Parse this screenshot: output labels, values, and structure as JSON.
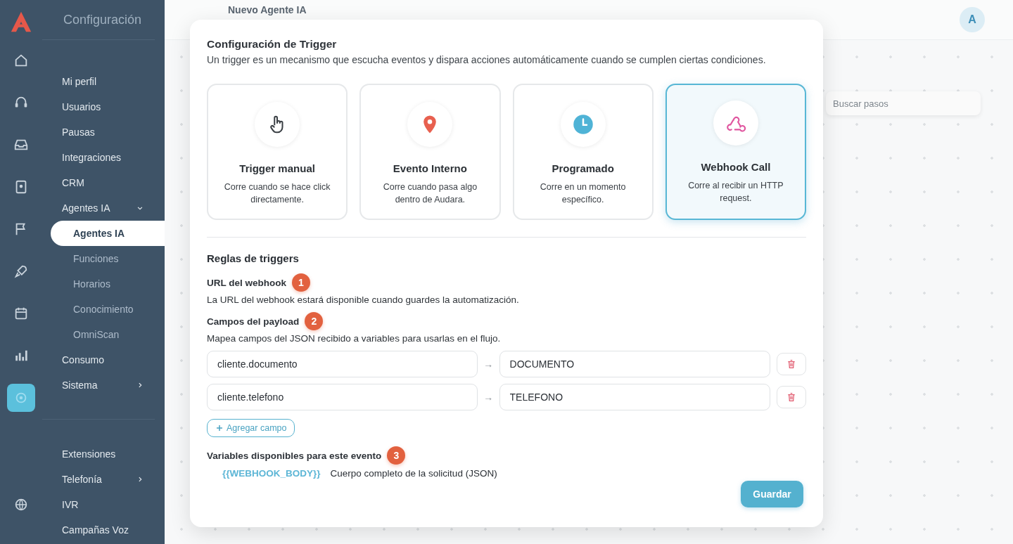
{
  "sidebar": {
    "title": "Configuración",
    "rail": [
      {
        "selected": false
      },
      {
        "selected": false
      },
      {
        "selected": false
      },
      {
        "selected": false
      },
      {
        "selected": false
      },
      {
        "selected": false
      },
      {
        "selected": false
      },
      {
        "selected": false
      },
      {
        "selected": true
      },
      {
        "selected": false
      }
    ],
    "items": [
      {
        "label": "Mi perfil",
        "selected": false
      },
      {
        "label": "Usuarios",
        "selected": false
      },
      {
        "label": "Pausas",
        "selected": false
      },
      {
        "label": "Integraciones",
        "selected": false
      },
      {
        "label": "CRM",
        "selected": false
      },
      {
        "label": "Agentes IA",
        "selected": false,
        "expanded": true,
        "children": [
          {
            "label": "Agentes IA",
            "selected": true
          },
          {
            "label": "Funciones",
            "selected": false
          },
          {
            "label": "Horarios",
            "selected": false
          },
          {
            "label": "Conocimiento",
            "selected": false
          },
          {
            "label": "OmniScan",
            "selected": false
          }
        ]
      },
      {
        "label": "Consumo",
        "selected": false
      },
      {
        "label": "Sistema",
        "selected": false,
        "expanded": false
      },
      {
        "kind": "divider"
      },
      {
        "label": "Extensiones",
        "selected": false
      },
      {
        "label": "Telefonía",
        "selected": false,
        "expanded": false
      },
      {
        "label": "IVR",
        "selected": false
      },
      {
        "label": "Campañas Voz",
        "selected": false
      }
    ]
  },
  "header": {
    "title": "Nuevo Agente IA",
    "avatar": "A"
  },
  "canvas": {
    "search": {
      "placeholder": "Buscar pasos"
    }
  },
  "modal": {
    "title": "Configuración de Trigger",
    "description": "Un trigger es un mecanismo que escucha eventos y dispara acciones automáticamente cuando se cumplen ciertas condiciones.",
    "triggers": [
      {
        "kind": "manual",
        "title": "Trigger manual",
        "description": "Corre cuando se hace click directamente.",
        "selected": false
      },
      {
        "kind": "event",
        "title": "Evento Interno",
        "description": "Corre cuando pasa algo dentro de Audara.",
        "selected": false
      },
      {
        "kind": "schedule",
        "title": "Programado",
        "description": "Corre en un momento específico.",
        "selected": false
      },
      {
        "kind": "webhook",
        "title": "Webhook Call",
        "description": "Corre al recibir un HTTP request.",
        "selected": true
      }
    ],
    "rules_title": "Reglas de triggers",
    "url_section": {
      "label": "URL del webhook",
      "badge": "1",
      "text": "La URL del webhook estará disponible cuando guardes la automatización."
    },
    "payload_section": {
      "label": "Campos del payload",
      "badge": "2",
      "text": "Mapea campos del JSON recibido a variables para usarlas en el flujo.",
      "fields": [
        {
          "source": "cliente.documento",
          "arrow": "→",
          "target": "DOCUMENTO"
        },
        {
          "source": "cliente.telefono",
          "arrow": "→",
          "target": "TELEFONO"
        }
      ],
      "add_button": "Agregar campo"
    },
    "variables_section": {
      "label": "Variables disponibles para este evento",
      "badge": "3",
      "items": [
        {
          "name": "{{WEBHOOK_BODY}}",
          "description": "Cuerpo completo de la solicitud (JSON)"
        }
      ]
    },
    "save_button": "Guardar"
  }
}
